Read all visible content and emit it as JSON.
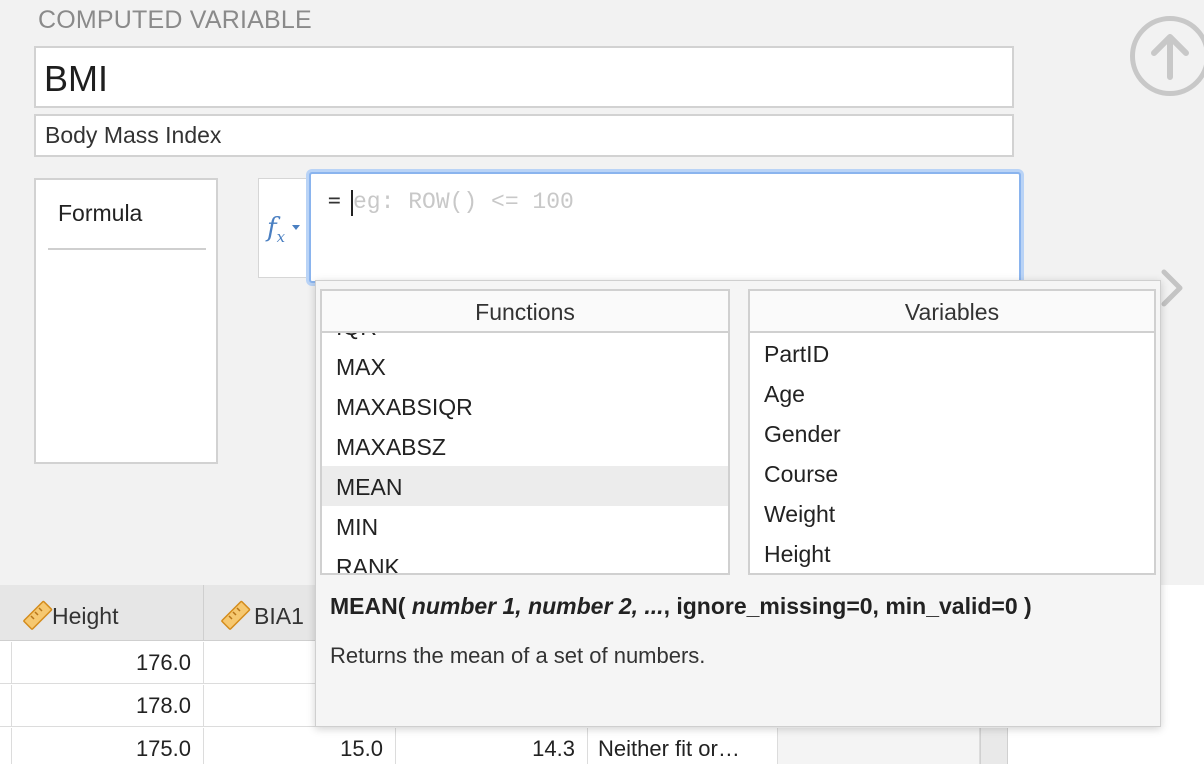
{
  "header": {
    "section_title": "COMPUTED VARIABLE"
  },
  "variable": {
    "name": "BMI",
    "description": "Body Mass Index"
  },
  "type_list": {
    "items": [
      "Formula"
    ]
  },
  "formula": {
    "prefix": "=",
    "value": "",
    "placeholder": "eg: ROW() <= 100",
    "fx_icon": "function-icon"
  },
  "functions_panel": {
    "title": "Functions",
    "items": [
      "IQR",
      "MAX",
      "MAXABSIQR",
      "MAXABSZ",
      "MEAN",
      "MIN",
      "RANK"
    ],
    "selected": "MEAN"
  },
  "variables_panel": {
    "title": "Variables",
    "items": [
      "PartID",
      "Age",
      "Gender",
      "Course",
      "Weight",
      "Height"
    ]
  },
  "help": {
    "signature_name": "MEAN(",
    "signature_args": "number 1, number 2, ...",
    "signature_rest": ", ignore_missing=0, min_valid=0 )",
    "description": "Returns the mean of a set of numbers."
  },
  "table": {
    "columns": [
      "Height",
      "BIA1"
    ],
    "rows": [
      [
        "176.0",
        "",
        "",
        ""
      ],
      [
        "178.0",
        "",
        "",
        ""
      ],
      [
        "175.0",
        "15.0",
        "14.3",
        "Neither fit or…"
      ]
    ]
  },
  "colors": {
    "accent": "#4a7fc1",
    "focus_ring": "#b9d3f6",
    "ruler_icon": "#e8a33a"
  }
}
